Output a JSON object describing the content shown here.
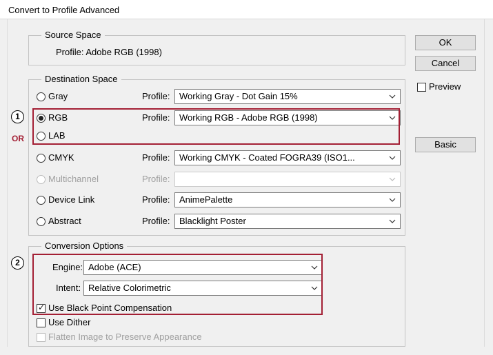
{
  "window": {
    "title": "Convert to Profile Advanced"
  },
  "source": {
    "legend": "Source Space",
    "profile_text": "Profile: Adobe RGB (1998)"
  },
  "destination": {
    "legend": "Destination Space",
    "profile_label": "Profile:",
    "rows": [
      {
        "label": "Gray",
        "value": "Working Gray - Dot Gain 15%",
        "checked": false,
        "disabled": false
      },
      {
        "label": "RGB",
        "value": "Working RGB - Adobe RGB (1998)",
        "checked": true,
        "disabled": false
      },
      {
        "label": "LAB",
        "value": "",
        "checked": false,
        "disabled": false
      },
      {
        "label": "CMYK",
        "value": "Working CMYK - Coated FOGRA39 (ISO1...",
        "checked": false,
        "disabled": false
      },
      {
        "label": "Multichannel",
        "value": "",
        "checked": false,
        "disabled": true
      },
      {
        "label": "Device Link",
        "value": "AnimePalette",
        "checked": false,
        "disabled": false
      },
      {
        "label": "Abstract",
        "value": "Blacklight Poster",
        "checked": false,
        "disabled": false
      }
    ]
  },
  "conversion": {
    "legend": "Conversion Options",
    "engine_label": "Engine:",
    "engine_value": "Adobe (ACE)",
    "intent_label": "Intent:",
    "intent_value": "Relative Colorimetric",
    "bpc_label": "Use Black Point Compensation",
    "bpc_checked": true,
    "dither_label": "Use Dither",
    "dither_checked": false,
    "flatten_label": "Flatten Image to Preserve Appearance",
    "flatten_disabled": true
  },
  "buttons": {
    "ok": "OK",
    "cancel": "Cancel",
    "preview": "Preview",
    "basic": "Basic"
  },
  "annotations": {
    "step1": "1",
    "step2": "2",
    "or": "OR",
    "accent_color": "#a31f34"
  }
}
